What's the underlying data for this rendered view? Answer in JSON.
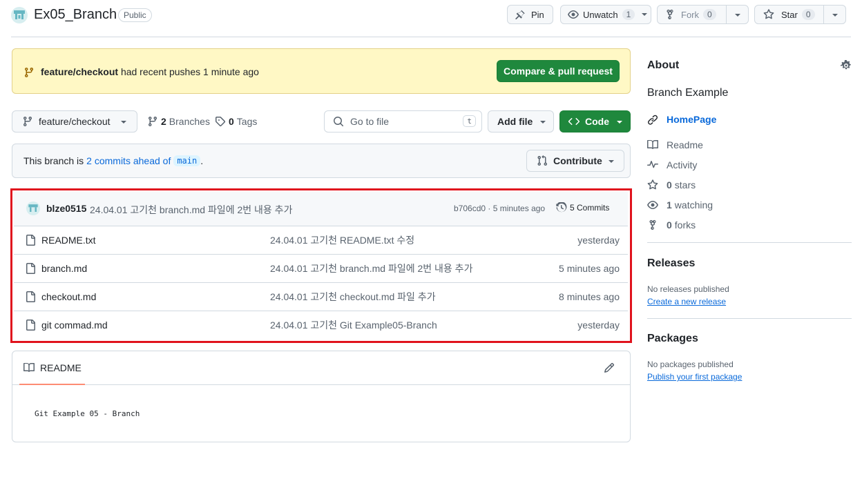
{
  "repo": {
    "name": "Ex05_Branch",
    "visibility": "Public"
  },
  "header_actions": {
    "pin": "Pin",
    "unwatch": "Unwatch",
    "unwatch_count": "1",
    "fork": "Fork",
    "fork_count": "0",
    "star": "Star",
    "star_count": "0"
  },
  "banner": {
    "branch": "feature/checkout",
    "text": "had recent pushes 1 minute ago",
    "button": "Compare & pull request"
  },
  "toolbar": {
    "branch": "feature/checkout",
    "branches_count": "2",
    "branches_label": "Branches",
    "tags_count": "0",
    "tags_label": "Tags",
    "goto_placeholder": "Go to file",
    "goto_shortcut": "t",
    "add_file": "Add file",
    "code": "Code"
  },
  "ahead": {
    "prefix": "This branch is",
    "link": "2 commits ahead of",
    "base": "main",
    "suffix": ".",
    "contribute": "Contribute"
  },
  "latest_commit": {
    "author": "blze0515",
    "message": "24.04.01 고기천 branch.md 파일에 2번 내용 추가",
    "hash_time": "b706cd0 · 5 minutes ago",
    "commits": "5 Commits"
  },
  "files": [
    {
      "name": "README.txt",
      "message": "24.04.01 고기천 README.txt 수정",
      "date": "yesterday"
    },
    {
      "name": "branch.md",
      "message": "24.04.01 고기천 branch.md 파일에 2번 내용 추가",
      "date": "5 minutes ago"
    },
    {
      "name": "checkout.md",
      "message": "24.04.01 고기천 checkout.md 파일 추가",
      "date": "8 minutes ago"
    },
    {
      "name": "git commad.md",
      "message": "24.04.01 고기천 Git Example05-Branch",
      "date": "yesterday"
    }
  ],
  "readme": {
    "tab": "README",
    "content": "Git Example 05 - Branch"
  },
  "about": {
    "title": "About",
    "description": "Branch Example",
    "homepage": "HomePage",
    "readme": "Readme",
    "activity": "Activity",
    "stars_count": "0",
    "stars_label": "stars",
    "watching_count": "1",
    "watching_label": "watching",
    "forks_count": "0",
    "forks_label": "forks"
  },
  "releases": {
    "title": "Releases",
    "empty": "No releases published",
    "link": "Create a new release"
  },
  "packages": {
    "title": "Packages",
    "empty": "No packages published",
    "link": "Publish your first package"
  },
  "colors": {
    "accent": "#0969da",
    "green": "#1f883d",
    "banner_bg": "#fff8c5",
    "highlight": "#e0131d"
  }
}
